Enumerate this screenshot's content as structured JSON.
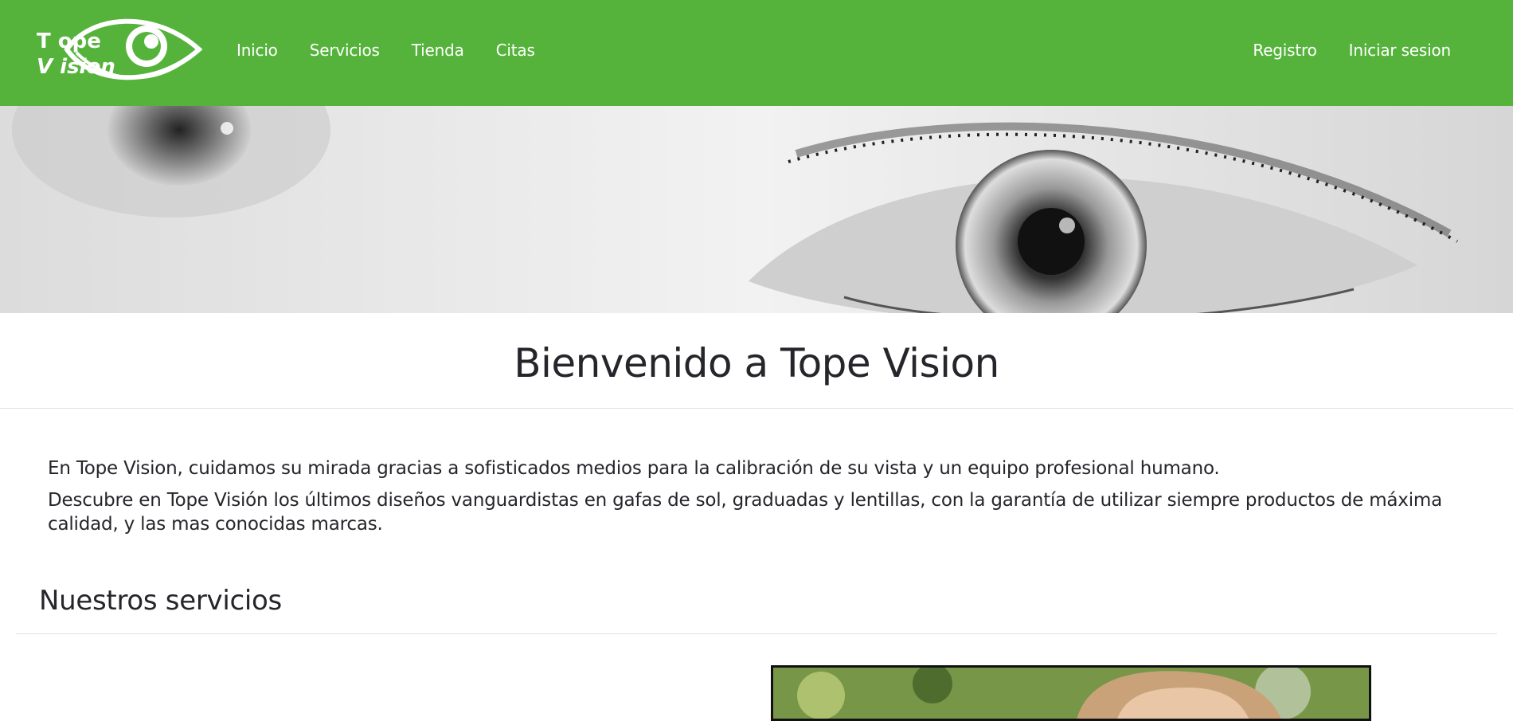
{
  "brand": {
    "logo_line1": "T ope",
    "logo_line2": "V ision",
    "color": "#55b33b"
  },
  "nav": {
    "left": [
      {
        "label": "Inicio"
      },
      {
        "label": "Servicios"
      },
      {
        "label": "Tienda"
      },
      {
        "label": "Citas"
      }
    ],
    "right": [
      {
        "label": "Registro"
      },
      {
        "label": "Iniciar sesion"
      }
    ]
  },
  "hero": {
    "image": "grayscale-eyes-banner"
  },
  "welcome": {
    "title": "Bienvenido a Tope Vision"
  },
  "intro": {
    "paragraph1": "En Tope Vision, cuidamos su mirada gracias a sofisticados medios para la calibración de su vista y un equipo profesional humano.",
    "paragraph2": "Descubre en Tope Visión los últimos diseños vanguardistas en gafas de sol, graduadas y lentillas, con la garantía de utilizar siempre productos de máxima calidad, y las mas conocidas marcas."
  },
  "services": {
    "title": "Nuestros servicios",
    "photo": "woman-outdoor-photo"
  }
}
